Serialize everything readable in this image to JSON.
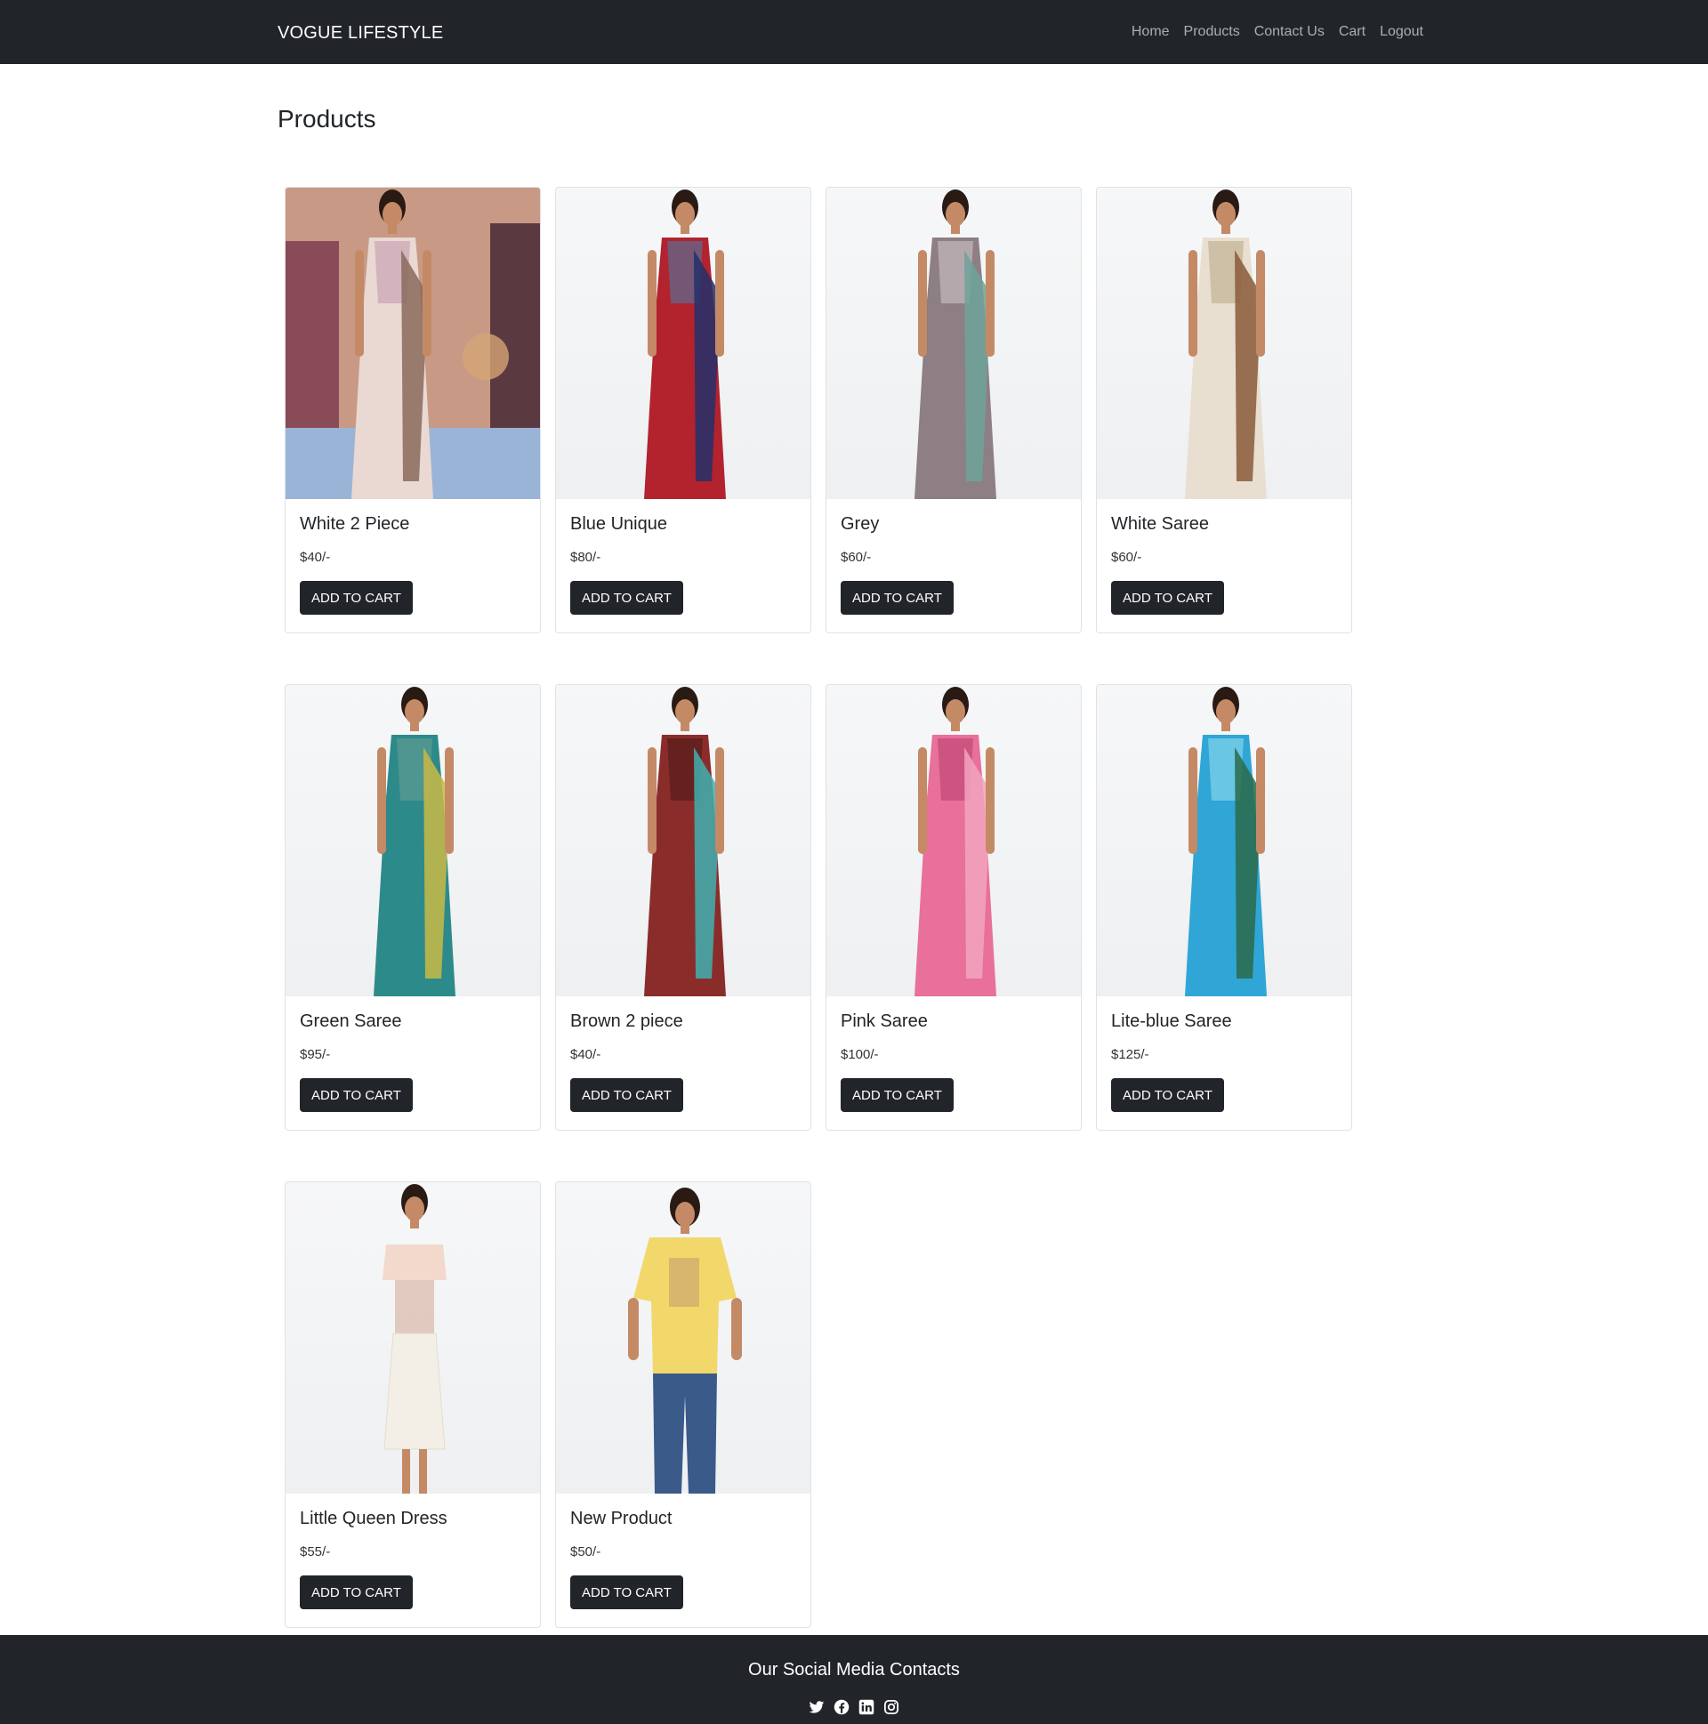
{
  "navbar": {
    "brand": "VOGUE LIFESTYLE",
    "links": [
      "Home",
      "Products",
      "Contact Us",
      "Cart",
      "Logout"
    ]
  },
  "page": {
    "title": "Products"
  },
  "products": [
    {
      "name": "White 2 Piece",
      "price": "$40/-",
      "button": "ADD TO CART",
      "palette": [
        "#e9d9d2",
        "#8a6a5c",
        "#c9a5b7"
      ]
    },
    {
      "name": "Blue Unique",
      "price": "$80/-",
      "button": "ADD TO CART",
      "palette": [
        "#b2232e",
        "#22306b",
        "#5e6a8c"
      ]
    },
    {
      "name": "Grey",
      "price": "$60/-",
      "button": "ADD TO CART",
      "palette": [
        "#8d7f84",
        "#6fa39a",
        "#c3b6ba"
      ]
    },
    {
      "name": "White Saree",
      "price": "$60/-",
      "button": "ADD TO CART",
      "palette": [
        "#e8dfd0",
        "#8a5a3a",
        "#c6b69a"
      ]
    },
    {
      "name": "Green Saree",
      "price": "$95/-",
      "button": "ADD TO CART",
      "palette": [
        "#2d8a8a",
        "#c9b845",
        "#5a9a90"
      ]
    },
    {
      "name": "Brown 2 piece",
      "price": "$40/-",
      "button": "ADD TO CART",
      "palette": [
        "#8a2d2a",
        "#3fb0b0",
        "#5a1e1c"
      ]
    },
    {
      "name": "Pink Saree",
      "price": "$100/-",
      "button": "ADD TO CART",
      "palette": [
        "#e8709a",
        "#f2a5c0",
        "#c44a78"
      ]
    },
    {
      "name": "Lite-blue Saree",
      "price": "$125/-",
      "button": "ADD TO CART",
      "palette": [
        "#2fa6d6",
        "#2a6a4a",
        "#7fd0ea"
      ]
    },
    {
      "name": "Little Queen Dress",
      "price": "$55/-",
      "button": "ADD TO CART",
      "palette": [
        "#f2d9cc",
        "#f4efe6",
        "#d8b8a8"
      ]
    },
    {
      "name": "New Product",
      "price": "$50/-",
      "button": "ADD TO CART",
      "palette": [
        "#f2d86a",
        "#3a5a8a",
        "#c8a070"
      ]
    }
  ],
  "footer": {
    "title": "Our Social Media Contacts",
    "icons": [
      "twitter-icon",
      "facebook-icon",
      "linkedin-icon",
      "instagram-icon"
    ]
  }
}
